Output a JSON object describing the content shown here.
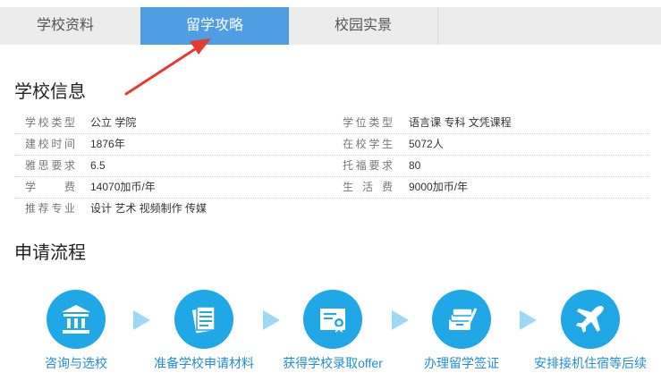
{
  "tabs": [
    {
      "label": "学校资料"
    },
    {
      "label": "留学攻略"
    },
    {
      "label": "校园实景"
    }
  ],
  "school_info": {
    "title": "学校信息",
    "rows": [
      {
        "l1": "学校类型",
        "v1": "公立 学院",
        "l2": "学位类型",
        "v2": "语言课 专科 文凭课程"
      },
      {
        "l1": "建校时间",
        "v1": "1876年",
        "l2": "在校学生",
        "v2": "5072人"
      },
      {
        "l1": "雅思要求",
        "v1": "6.5",
        "l2": "托福要求",
        "v2": "80"
      },
      {
        "l1": "学费",
        "v1": "14070加币/年",
        "l2": "生活费",
        "v2": "9000加币/年"
      },
      {
        "l1": "推荐专业",
        "v1": "设计 艺术 视频制作 传媒"
      }
    ]
  },
  "process": {
    "title": "申请流程",
    "steps": [
      {
        "label": "咨询与选校",
        "icon": "university-building-icon"
      },
      {
        "label": "准备学校申请材料",
        "icon": "documents-icon"
      },
      {
        "label": "获得学校录取offer",
        "icon": "certificate-icon"
      },
      {
        "label": "办理留学签证",
        "icon": "passport-visa-icon"
      },
      {
        "label": "安排接机住宿等后续",
        "icon": "airplane-icon"
      }
    ]
  },
  "colors": {
    "tab_active": "#4f9de3",
    "circle": "#1fa7e6",
    "step_text": "#1f8fd1",
    "arrow": "#e23c32"
  }
}
